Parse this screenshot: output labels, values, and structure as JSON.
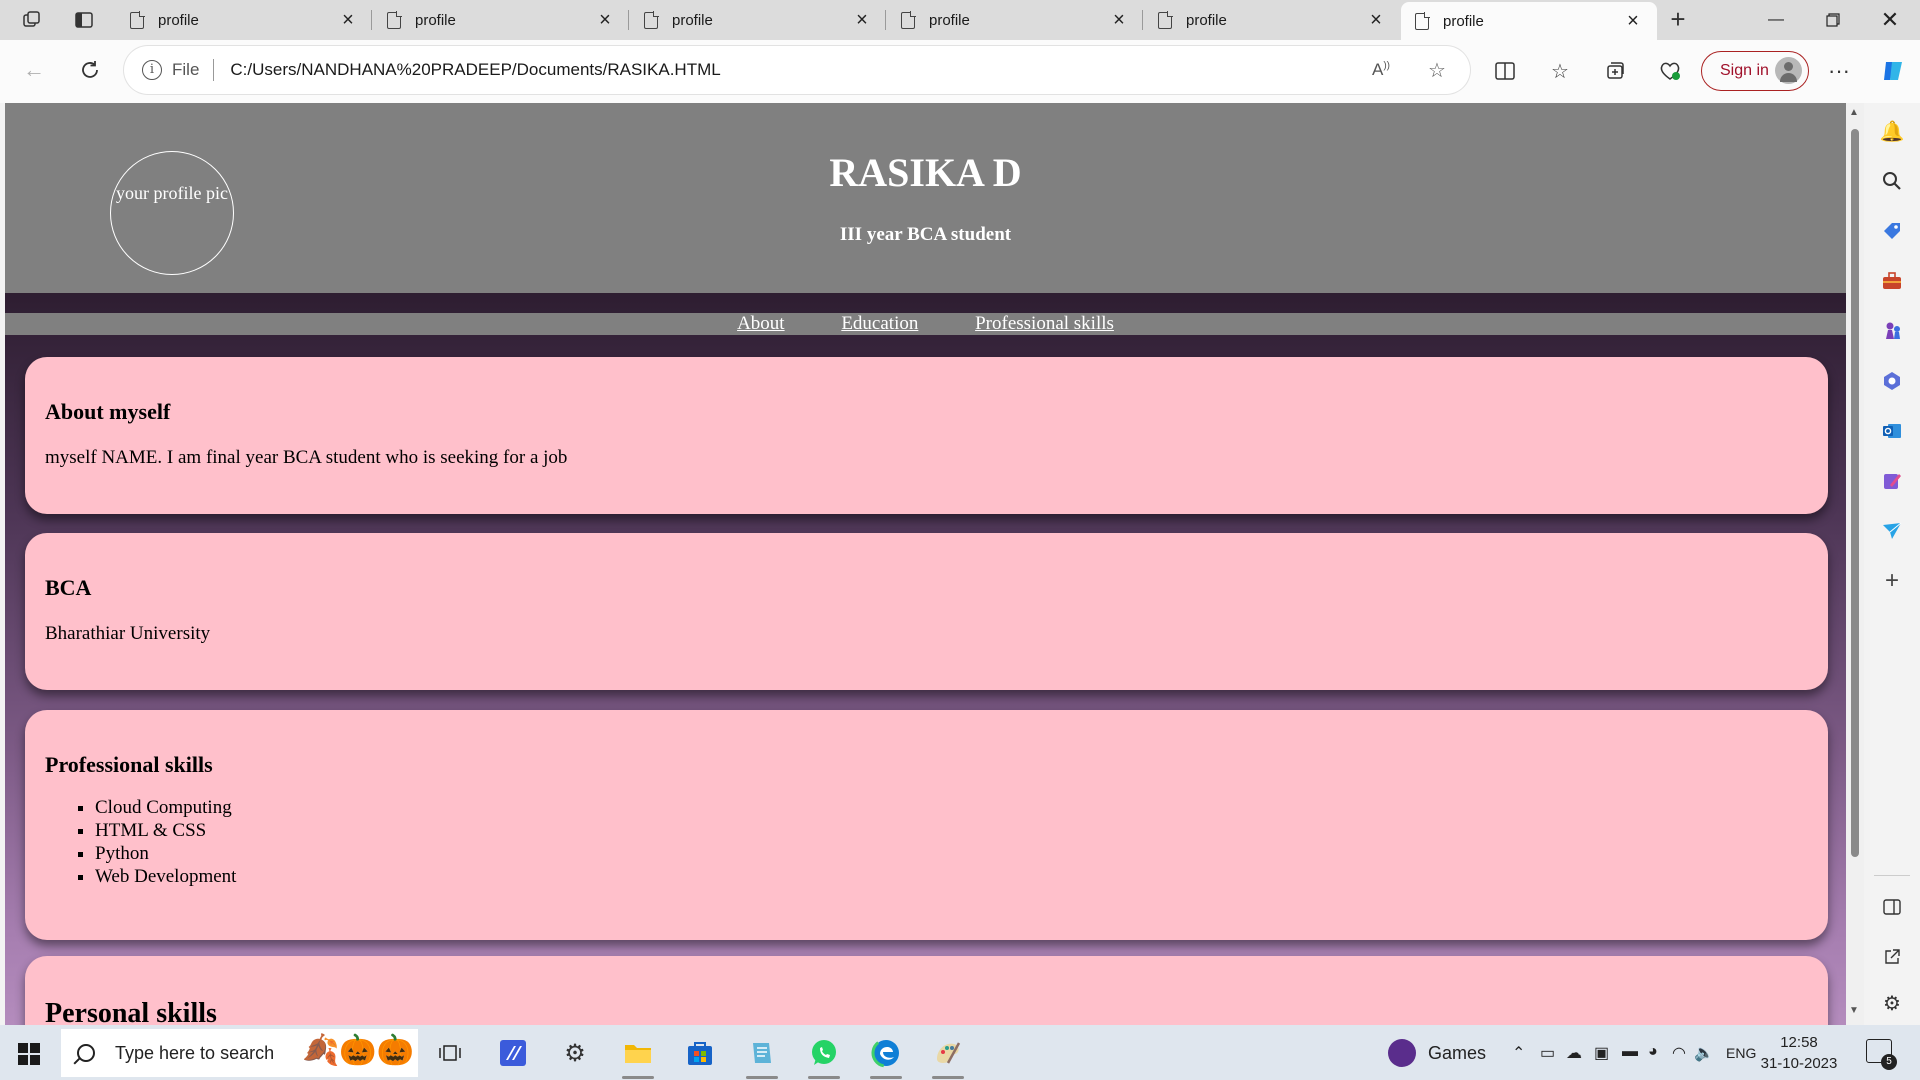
{
  "browser": {
    "tabs": [
      {
        "title": "profile"
      },
      {
        "title": "profile"
      },
      {
        "title": "profile"
      },
      {
        "title": "profile"
      },
      {
        "title": "profile"
      },
      {
        "title": "profile",
        "active": true
      }
    ],
    "address": {
      "scheme": "File",
      "url": "C:/Users/NANDHANA%20PRADEEP/Documents/RASIKA.HTML"
    },
    "sign_in_label": "Sign in"
  },
  "page": {
    "profile_pic_alt": "your profile pic",
    "name": "RASIKA D",
    "role": "III year BCA student",
    "nav": [
      "About",
      "Education",
      "Professional skills"
    ],
    "about": {
      "heading": "About myself",
      "text": "myself NAME. I am final year BCA student who is seeking for a job"
    },
    "education": {
      "heading": "BCA",
      "text": "Bharathiar University"
    },
    "professional_skills": {
      "heading": "Professional skills",
      "items": [
        "Cloud Computing",
        "HTML & CSS",
        "Python",
        "Web Development"
      ]
    },
    "personal_skills": {
      "heading": "Personal skills"
    },
    "colors": {
      "header_bg": "#808080",
      "card_bg": "#ffc0cb"
    }
  },
  "taskbar": {
    "search_placeholder": "Type here to search",
    "games_label": "Games",
    "language": "ENG",
    "time": "12:58",
    "date": "31-10-2023",
    "notification_count": "5"
  }
}
